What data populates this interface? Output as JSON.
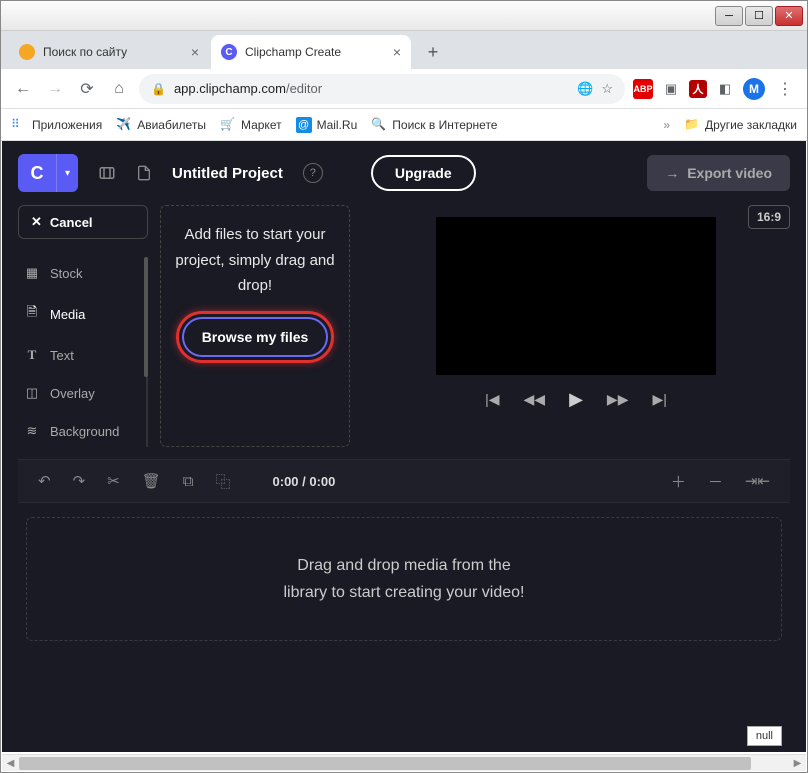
{
  "window": {
    "tabs": [
      {
        "title": "Поиск по сайту",
        "favicon_color": "#f5a623"
      },
      {
        "title": "Clipchamp Create",
        "favicon_color": "#5a5af5"
      }
    ],
    "url_domain": "app.clipchamp.com",
    "url_path": "/editor"
  },
  "bookmarks": {
    "apps": "Приложения",
    "avia": "Авиабилеты",
    "market": "Маркет",
    "mailru": "Mail.Ru",
    "search": "Поиск в Интернете",
    "more": "»",
    "other": "Другие закладки"
  },
  "header": {
    "logo": "C",
    "project_title": "Untitled Project",
    "upgrade": "Upgrade",
    "export": "Export video"
  },
  "sidebar": {
    "cancel": "Cancel",
    "items": [
      {
        "label": "Stock"
      },
      {
        "label": "Media"
      },
      {
        "label": "Text"
      },
      {
        "label": "Overlay"
      },
      {
        "label": "Background"
      }
    ]
  },
  "media_panel": {
    "prompt": "Add files to start your project, simply drag and drop!",
    "browse": "Browse my files"
  },
  "preview": {
    "aspect": "16:9"
  },
  "toolbar": {
    "time": "0:00 / 0:00"
  },
  "timeline": {
    "line1": "Drag and drop media from the",
    "line2": "library to start creating your video!"
  },
  "footer": {
    "null_label": "null"
  }
}
